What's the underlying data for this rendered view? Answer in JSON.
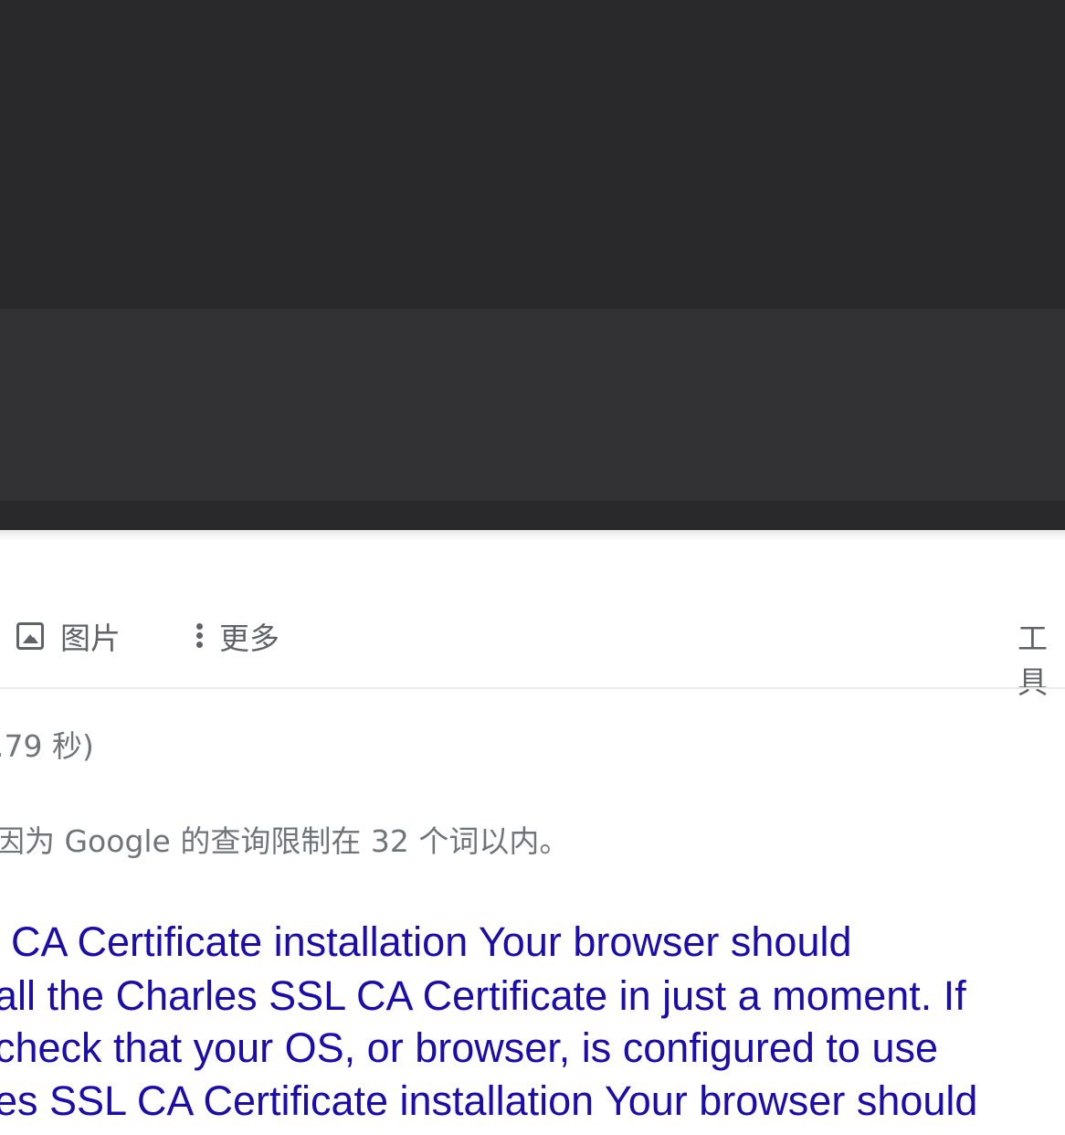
{
  "tabs": {
    "images_label": "图片",
    "more_label": "更多",
    "tools_label": "工具"
  },
  "results": {
    "stats": ".79 秒)",
    "notice": "因为 Google 的查询限制在 32 个词以内。",
    "first_result_title_lines": [
      "CA Certificate installation Your browser should",
      "all the Charles SSL CA Certificate in just a moment. If",
      "check that your OS, or browser, is configured to use",
      "es SSL CA Certificate installation Your browser should"
    ]
  },
  "colors": {
    "chrome_dark": "#29292b",
    "chrome_toolbar": "#323234",
    "link_blue": "#1a0dab",
    "muted_text": "#70757a",
    "tab_text": "#5f6368"
  },
  "icons": {
    "images_tab": "image-icon",
    "more_tab": "vertical-dots-icon"
  }
}
